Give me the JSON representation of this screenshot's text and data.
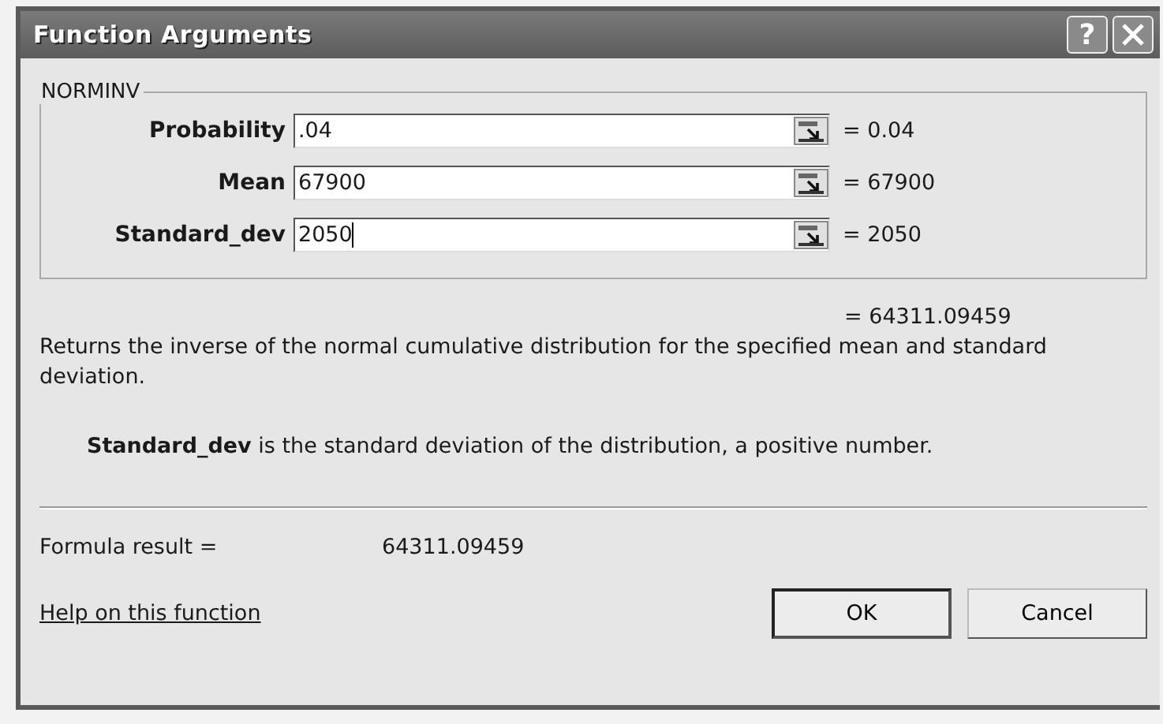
{
  "window": {
    "title": "Function Arguments",
    "help": "?"
  },
  "function_name": "NORMINV",
  "arguments": [
    {
      "label": "Probability",
      "value": ".04",
      "result": "= 0.04",
      "focused": false
    },
    {
      "label": "Mean",
      "value": "67900",
      "result": "= 67900",
      "focused": false
    },
    {
      "label": "Standard_dev",
      "value": "2050",
      "result": "= 2050",
      "focused": true
    }
  ],
  "result": "= 64311.09459",
  "description": "Returns the inverse of the normal cumulative distribution for the specified mean and standard deviation.",
  "argument_help": "**Standard_dev** is the standard deviation of the distribution, a positive number.",
  "formula_result": {
    "label": "Formula result =",
    "value": "64311.09459"
  },
  "help_link": "Help on this function",
  "buttons": [
    {
      "label": "OK",
      "kind": "default"
    },
    {
      "label": "Cancel",
      "kind": "normal"
    }
  ]
}
